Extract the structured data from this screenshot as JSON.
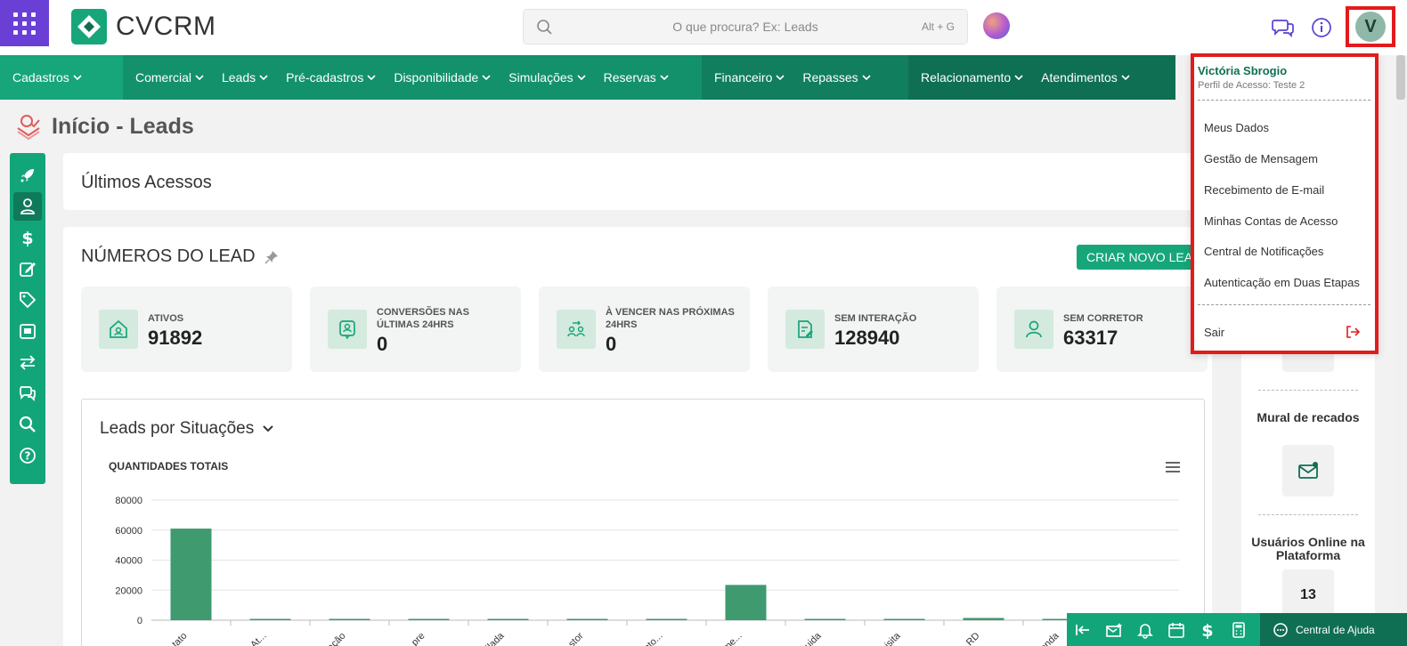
{
  "header": {
    "brand": "CVCRM",
    "search_placeholder": "O que procura? Ex: Leads",
    "search_shortcut": "Alt + G",
    "user_initial": "V"
  },
  "nav": {
    "items": [
      {
        "label": "Cadastros"
      },
      {
        "label": "Comercial"
      },
      {
        "label": "Leads"
      },
      {
        "label": "Pré-cadastros"
      },
      {
        "label": "Disponibilidade"
      },
      {
        "label": "Simulações"
      },
      {
        "label": "Reservas"
      },
      {
        "label": "Financeiro"
      },
      {
        "label": "Repasses"
      },
      {
        "label": "Relacionamento"
      },
      {
        "label": "Atendimentos"
      }
    ]
  },
  "page": {
    "title": "Início - Leads"
  },
  "recent": {
    "title": "Últimos Acessos"
  },
  "numbers": {
    "title": "NÚMEROS DO LEAD",
    "new_lead_button": "CRIAR NOVO LEAD",
    "stats": [
      {
        "label": "ATIVOS",
        "value": "91892",
        "icon": "home-icon"
      },
      {
        "label": "CONVERSÕES NAS ÚLTIMAS 24HRS",
        "value": "0",
        "icon": "user-badge-icon"
      },
      {
        "label": "À VENCER NAS PRÓXIMAS 24HRS",
        "value": "0",
        "icon": "users-transfer-icon"
      },
      {
        "label": "SEM INTERAÇÃO",
        "value": "128940",
        "icon": "document-edit-icon"
      },
      {
        "label": "SEM CORRETOR",
        "value": "63317",
        "icon": "user-icon"
      }
    ]
  },
  "chart_section": {
    "title": "Leads por Situações",
    "subtitle": "QUANTIDADES TOTAIS"
  },
  "chart_data": {
    "type": "bar",
    "categories": [
      "...tato",
      "At...",
      "...ação",
      "...pre",
      "...ilada",
      "...stor",
      "...nto...",
      "...me...",
      "...uida",
      "...isita",
      "...RD",
      "...enda"
    ],
    "values": [
      61000,
      300,
      300,
      300,
      300,
      300,
      300,
      23500,
      300,
      300,
      1500,
      300
    ],
    "ylim": [
      0,
      80000
    ],
    "yticks": [
      0,
      20000,
      40000,
      60000,
      80000
    ],
    "color": "#3f9a70",
    "grid": true
  },
  "right_panel": {
    "mural_label": "Mural de recados",
    "online_label": "Usuários Online na Plataforma",
    "online_count": "13"
  },
  "user_menu": {
    "name": "Victória Sbrogio",
    "profile": "Perfil de Acesso: Teste 2",
    "items": [
      {
        "label": "Meus Dados"
      },
      {
        "label": "Gestão de Mensagem"
      },
      {
        "label": "Recebimento de E-mail"
      },
      {
        "label": "Minhas Contas de Acesso"
      },
      {
        "label": "Central de Notificações"
      },
      {
        "label": "Autenticação em Duas Etapas"
      }
    ],
    "logout": "Sair"
  },
  "bottom_bar": {
    "help_label": "Central de Ajuda"
  },
  "colors": {
    "brand_green": "#13a57a",
    "dark_green": "#0f6f53",
    "highlight_red": "#e21b1b",
    "apps_purple": "#6a3fd6"
  }
}
